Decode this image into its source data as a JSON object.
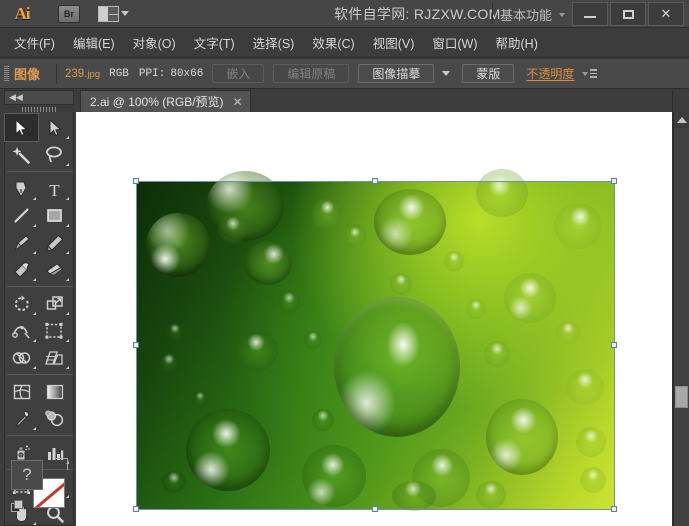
{
  "titlebar": {
    "app_logo": "Ai",
    "bridge_icon": "br-icon",
    "arrange_icon": "arrange-documents-icon",
    "site_text": "软件自学网: RJZXW.COM",
    "workspace_label": "基本功能",
    "minimize": "—",
    "maximize": "□",
    "close": "✕"
  },
  "menubar": {
    "items": [
      {
        "label": "文件(F)"
      },
      {
        "label": "编辑(E)"
      },
      {
        "label": "对象(O)"
      },
      {
        "label": "文字(T)"
      },
      {
        "label": "选择(S)"
      },
      {
        "label": "效果(C)"
      },
      {
        "label": "视图(V)"
      },
      {
        "label": "窗口(W)"
      },
      {
        "label": "帮助(H)"
      }
    ]
  },
  "controlbar": {
    "object_type": "图像",
    "file_name": "239.",
    "file_ext": "jpg",
    "color_mode": "RGB",
    "ppi_label": "PPI:",
    "ppi_value": "80x66",
    "embed_button": "嵌入",
    "edit_original_button": "编辑原稿",
    "image_trace_button": "图像描摹",
    "mask_button": "蒙版",
    "opacity_label": "不透明度"
  },
  "tabbar": {
    "collapse_label": "◀◀",
    "document_tab": "2.ai @ 100% (RGB/预览)",
    "close_glyph": "✕"
  },
  "toolpanel": {
    "tools": [
      {
        "name": "selection-tool",
        "active": true
      },
      {
        "name": "direct-selection-tool",
        "active": false
      },
      {
        "name": "magic-wand-tool",
        "active": false
      },
      {
        "name": "lasso-tool",
        "active": false
      },
      {
        "name": "pen-tool",
        "active": false
      },
      {
        "name": "type-tool",
        "active": false
      },
      {
        "name": "line-segment-tool",
        "active": false
      },
      {
        "name": "rectangle-tool",
        "active": false
      },
      {
        "name": "paintbrush-tool",
        "active": false
      },
      {
        "name": "pencil-tool",
        "active": false
      },
      {
        "name": "blob-brush-tool",
        "active": false
      },
      {
        "name": "eraser-tool",
        "active": false
      },
      {
        "name": "rotate-tool",
        "active": false
      },
      {
        "name": "scale-tool",
        "active": false
      },
      {
        "name": "width-tool",
        "active": false
      },
      {
        "name": "free-transform-tool",
        "active": false
      },
      {
        "name": "shape-builder-tool",
        "active": false
      },
      {
        "name": "perspective-grid-tool",
        "active": false
      },
      {
        "name": "mesh-tool",
        "active": false
      },
      {
        "name": "gradient-tool",
        "active": false
      },
      {
        "name": "eyedropper-tool",
        "active": false
      },
      {
        "name": "blend-tool",
        "active": false
      },
      {
        "name": "symbol-sprayer-tool",
        "active": false
      },
      {
        "name": "column-graph-tool",
        "active": false
      },
      {
        "name": "artboard-tool",
        "active": false
      },
      {
        "name": "slice-tool",
        "active": false
      },
      {
        "name": "hand-tool",
        "active": false
      },
      {
        "name": "zoom-tool",
        "active": false
      }
    ],
    "fill_label": "?",
    "stroke_label": "none"
  },
  "canvas": {
    "artboard_background": "#ffffff",
    "image_alt": "green-water-droplets-image",
    "selected": true
  },
  "colors": {
    "app_background": "#3c3c3c",
    "panel_background": "#3f3f3f",
    "titlebar": "#464646",
    "controlbar": "#494949",
    "accent_orange": "#e09a4e",
    "text_primary": "#d6d6d6",
    "selection_handle": "#e7f0f7",
    "selection_edge": "#6f93ad",
    "canvas_white": "#ffffff",
    "image_dark_green": "#0d2d08",
    "image_light_green": "#cfe334"
  }
}
